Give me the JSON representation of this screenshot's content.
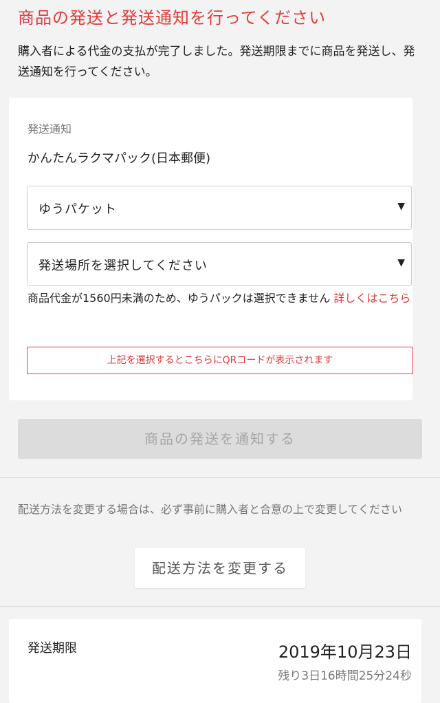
{
  "header": {
    "title": "商品の発送と発送通知を行ってください",
    "description": "購入者による代金の支払が完了しました。発送期限までに商品を発送し、発送通知を行ってください。"
  },
  "shipping_card": {
    "section_label": "発送通知",
    "method": "かんたんラクマパック(日本郵便)",
    "service_select": {
      "value": "ゆうパケット"
    },
    "location_select": {
      "value": "発送場所を選択してください"
    },
    "notice_text": "商品代金が1560円未満のため、ゆうパックは選択できません",
    "notice_link": "詳しくはこちら",
    "qr_message": "上記を選択するとこちらにQRコードが表示されます"
  },
  "notify_button": {
    "label": "商品の発送を通知する"
  },
  "change_section": {
    "text": "配送方法を変更する場合は、必ず事前に購入者と合意の上で変更してください",
    "button_label": "配送方法を変更する"
  },
  "deadline": {
    "label": "発送期限",
    "date": "2019年10月23日",
    "remaining": "残り3日16時間25分24秒"
  },
  "colors": {
    "accent": "#e53a3a",
    "background": "#f3f3f3",
    "disabled_button": "#dcdcdc"
  },
  "icons": {
    "select_arrow": "triangle-down-icon"
  }
}
